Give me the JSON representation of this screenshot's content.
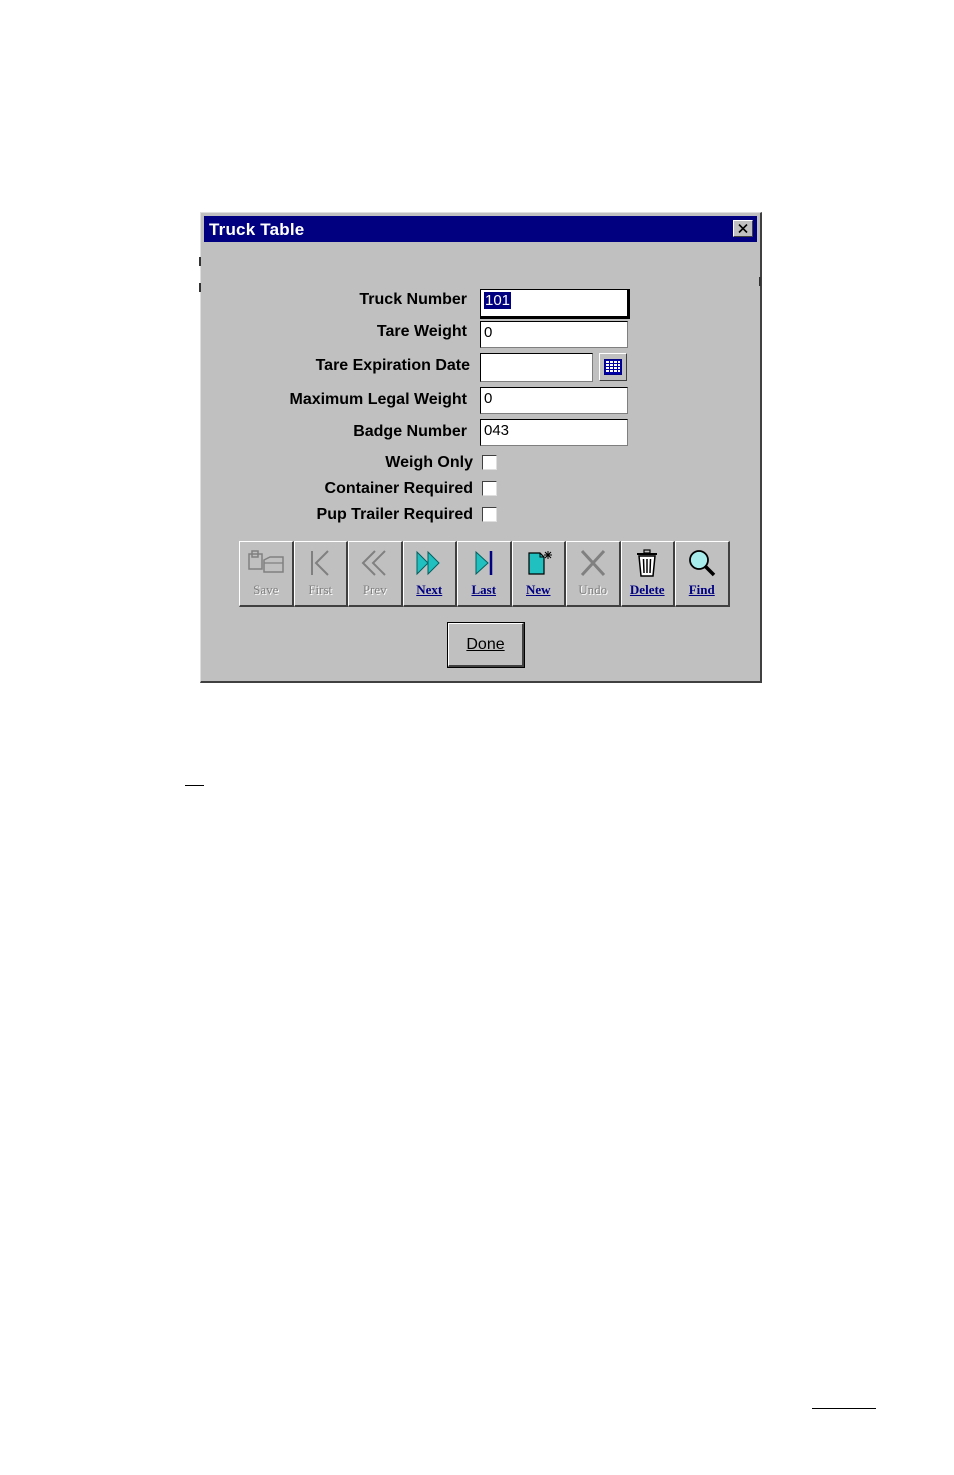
{
  "window": {
    "title": "Truck Table",
    "titlebar_color": "#000080",
    "face_color": "#c0c0c0"
  },
  "form": {
    "truck_number": {
      "label": "Truck Number",
      "value": "101"
    },
    "tare_weight": {
      "label": "Tare Weight",
      "value": "0"
    },
    "tare_expiration_date": {
      "label": "Tare Expiration Date",
      "value": ""
    },
    "maximum_legal_weight": {
      "label": "Maximum Legal Weight",
      "value": "0"
    },
    "badge_number": {
      "label": "Badge Number",
      "value": "043"
    },
    "weigh_only": {
      "label": "Weigh Only",
      "checked": false
    },
    "container_required": {
      "label": "Container Required",
      "checked": false
    },
    "pup_trailer_required": {
      "label": "Pup Trailer Required",
      "checked": false
    }
  },
  "toolbar": {
    "buttons": [
      {
        "label": "Save",
        "icon": "save-icon",
        "enabled": false
      },
      {
        "label": "First",
        "icon": "first-record-icon",
        "enabled": false
      },
      {
        "label": "Prev",
        "icon": "previous-record-icon",
        "enabled": false
      },
      {
        "label": "Next",
        "icon": "next-record-icon",
        "enabled": true
      },
      {
        "label": "Last",
        "icon": "last-record-icon",
        "enabled": true
      },
      {
        "label": "New",
        "icon": "new-record-icon",
        "enabled": true
      },
      {
        "label": "Undo",
        "icon": "undo-icon",
        "enabled": false
      },
      {
        "label": "Delete",
        "icon": "trash-icon",
        "enabled": true
      },
      {
        "label": "Find",
        "icon": "magnifier-icon",
        "enabled": true
      }
    ]
  },
  "done_button": {
    "label": "Done"
  }
}
